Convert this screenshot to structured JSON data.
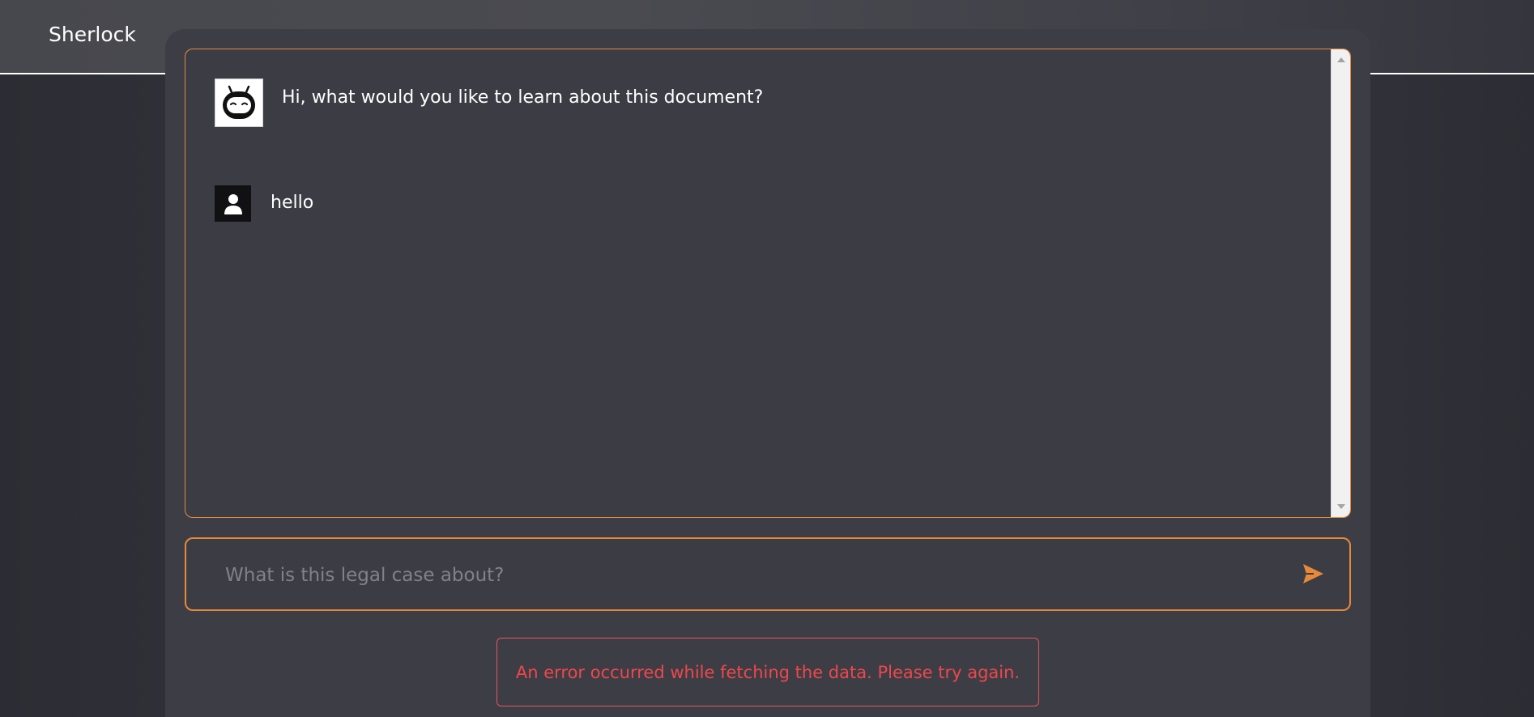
{
  "app": {
    "brand": "Sherlock"
  },
  "chat": {
    "messages": [
      {
        "role": "bot",
        "avatar_icon": "robot-icon",
        "text": "Hi, what would you like to learn about this document?"
      },
      {
        "role": "user",
        "avatar_icon": "user-icon",
        "text": "hello"
      }
    ]
  },
  "composer": {
    "placeholder": "What is this legal case about?",
    "value": "",
    "send_icon": "send-icon"
  },
  "error": {
    "message": "An error occurred while fetching the data. Please try again."
  },
  "colors": {
    "accent": "#e7893a",
    "error": "#f0464c",
    "background": "#3d3e45",
    "text": "#ffffff"
  }
}
